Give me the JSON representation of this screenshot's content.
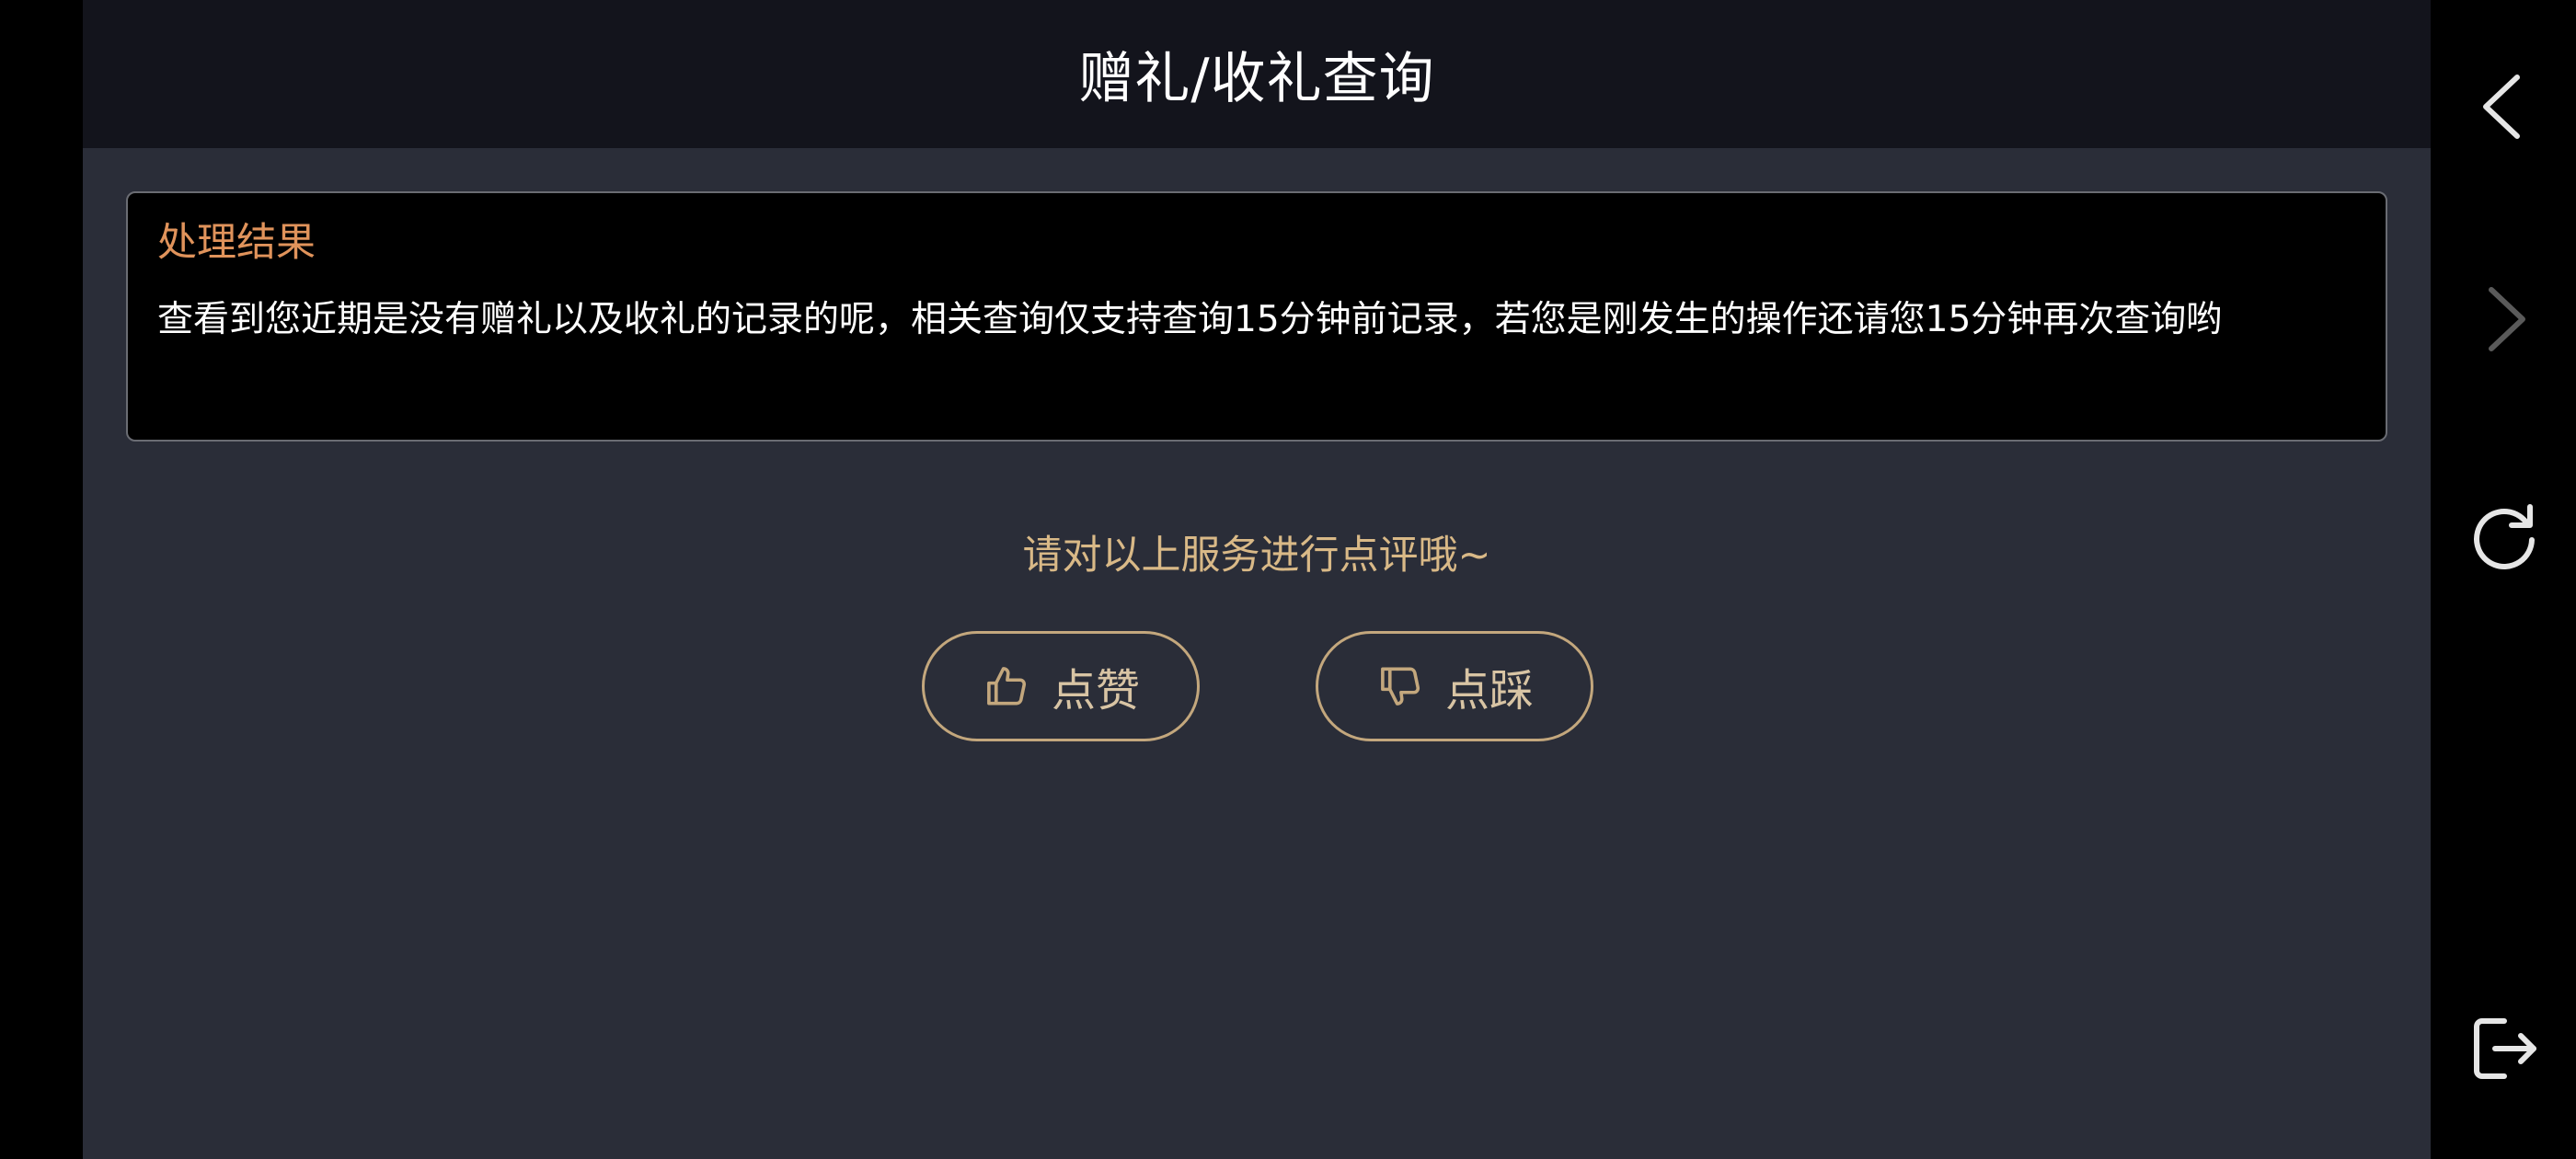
{
  "header": {
    "title": "赠礼/收礼查询"
  },
  "result": {
    "heading": "处理结果",
    "body": "查看到您近期是没有赠礼以及收礼的记录的呢，相关查询仅支持查询15分钟前记录，若您是刚发生的操作还请您15分钟再次查询哟"
  },
  "rating": {
    "prompt": "请对以上服务进行点评哦~",
    "like_label": "点赞",
    "dislike_label": "点踩",
    "like_icon": "thumbs-up-icon",
    "dislike_icon": "thumbs-down-icon"
  },
  "side_rail": {
    "icons": [
      "back-arrow-icon",
      "forward-arrow-icon",
      "reload-icon",
      "exit-icon"
    ]
  },
  "colors": {
    "page_background": "#2a2d38",
    "header_background": "#13141c",
    "card_background": "#000000",
    "heading_accent": "#e0935b",
    "prompt_gold": "#d9b987",
    "button_border": "#c3a77d",
    "rail_icon": "#e6e6e6",
    "rail_icon_disabled": "#5a5a5a"
  }
}
